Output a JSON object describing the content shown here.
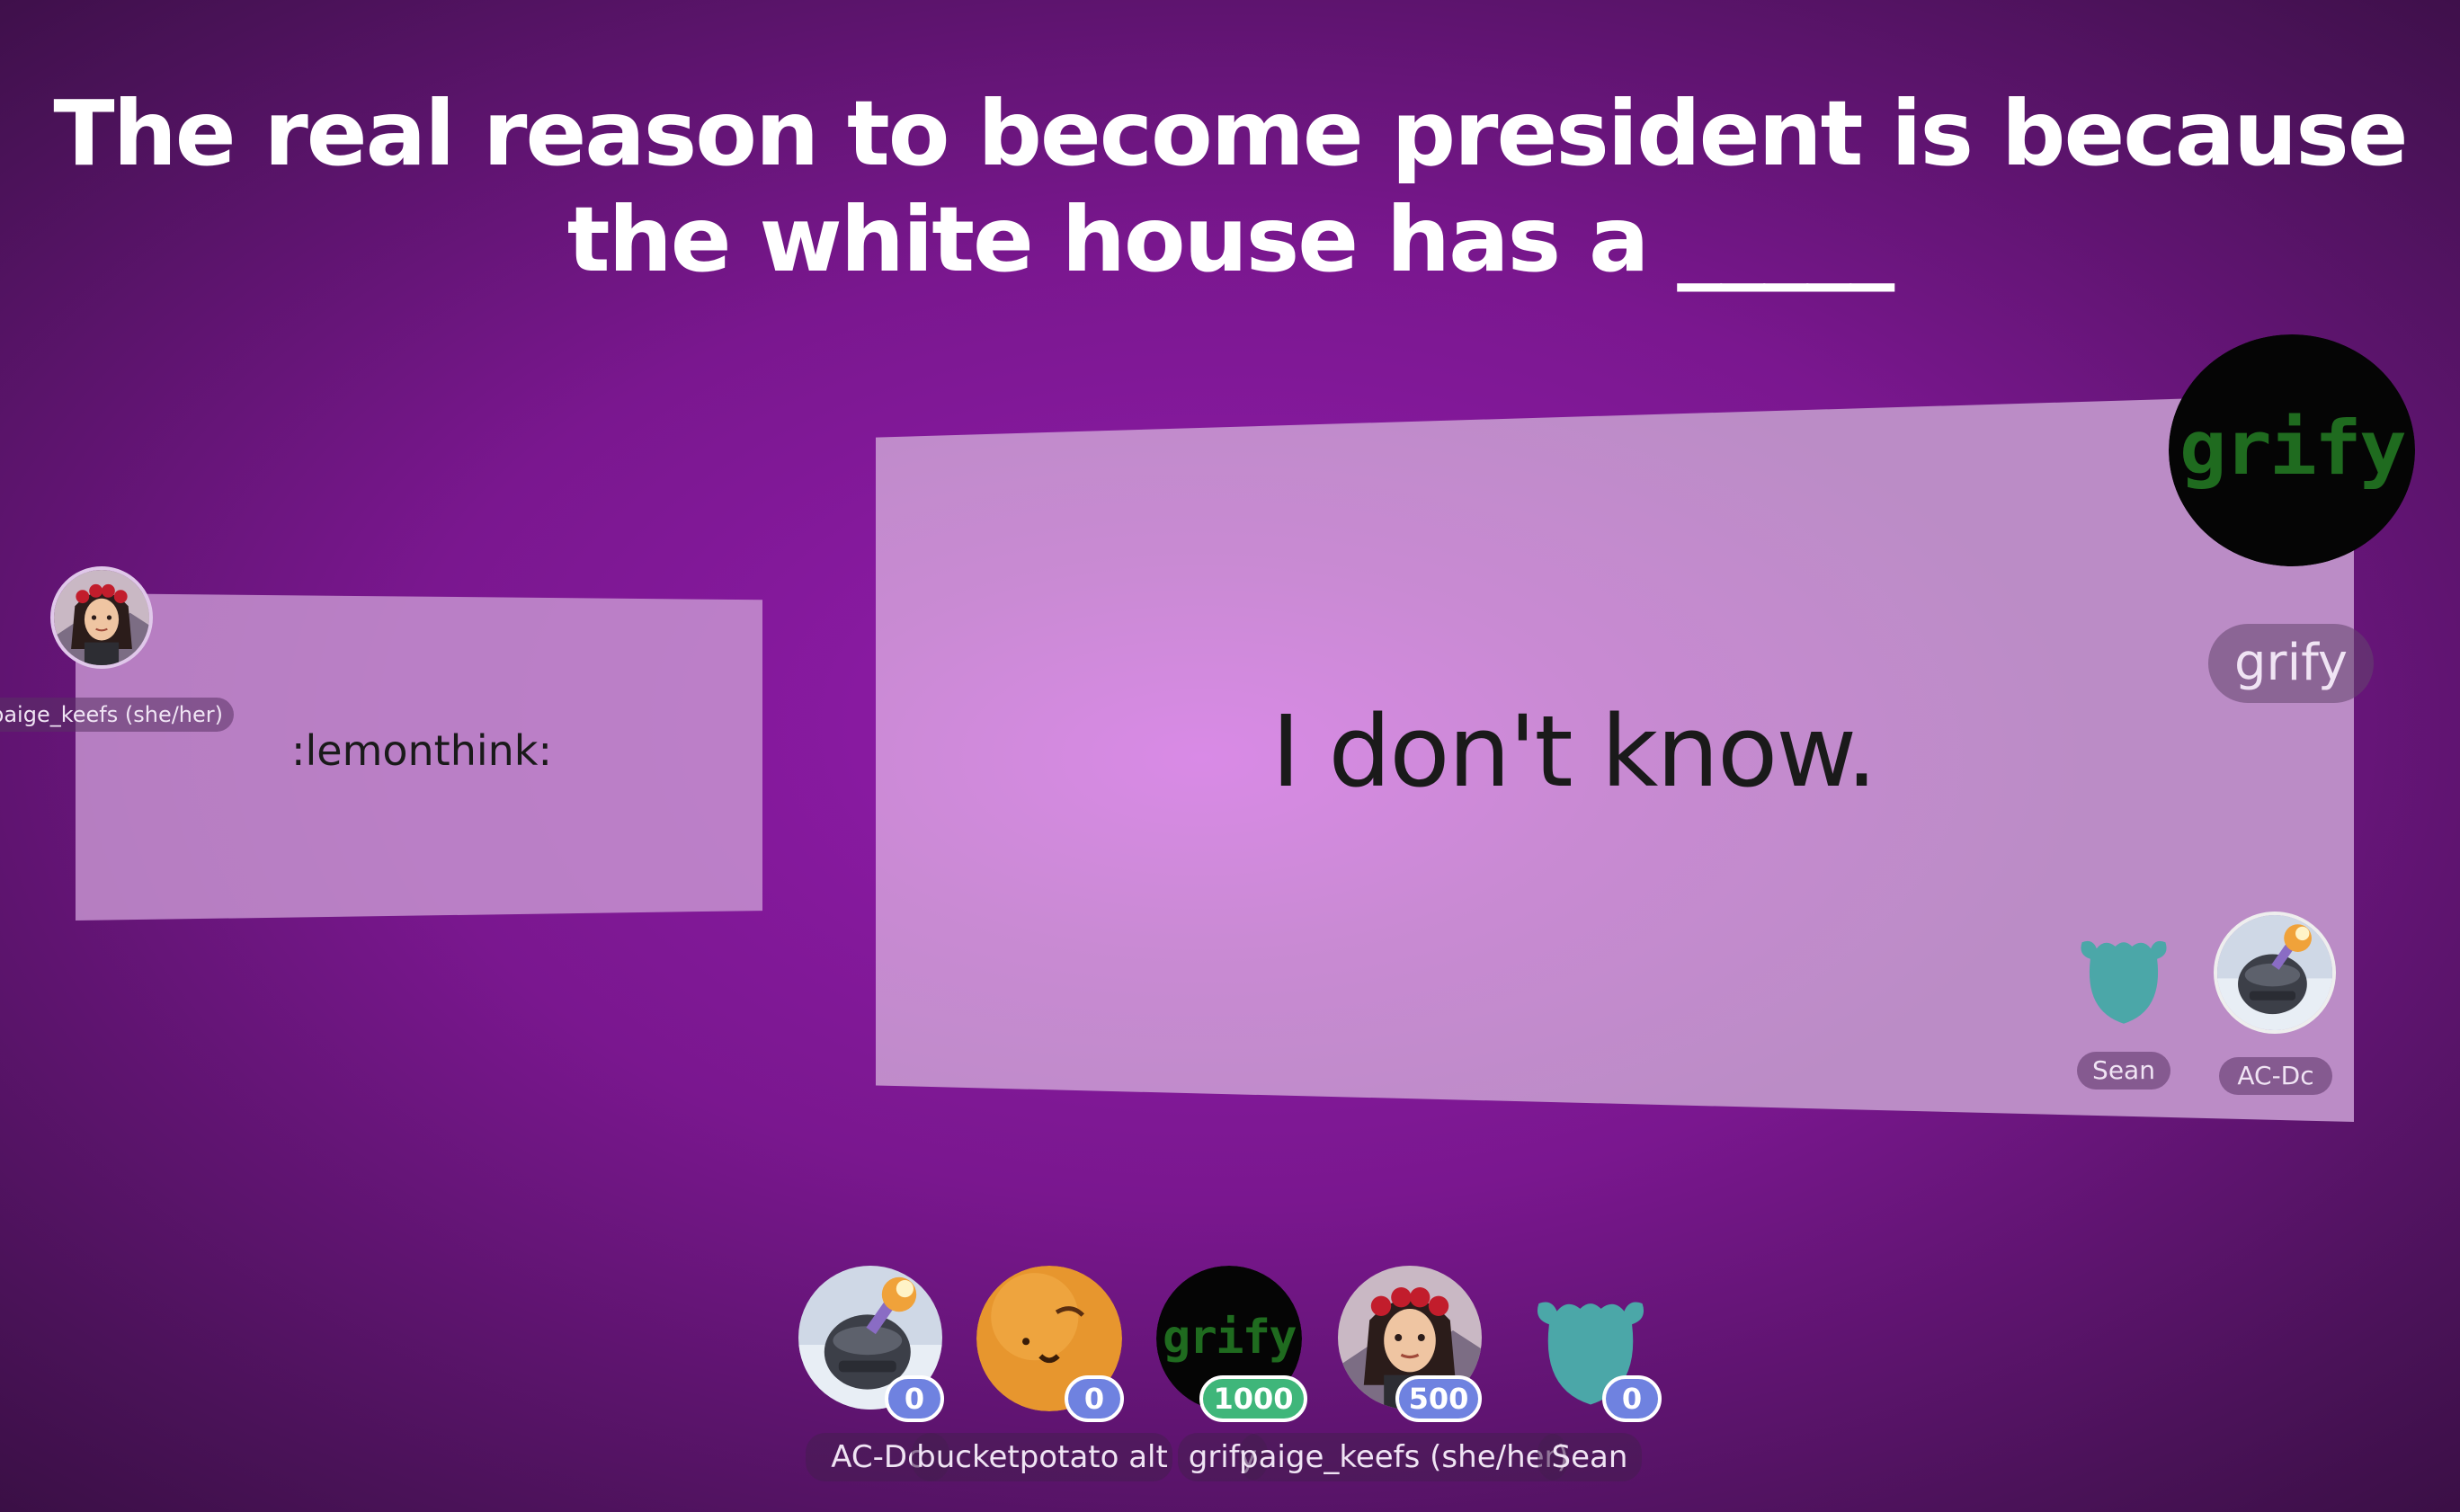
{
  "prompt": {
    "line1": "The real reason to become president is because",
    "line2": "the white house has a _____"
  },
  "answers": {
    "left": {
      "text": ":lemonthink:",
      "author": "paige_keefs (she/her)"
    },
    "main": {
      "text": "I don't know.",
      "author": "grify",
      "voters": [
        {
          "name": "Sean",
          "avatar": "teal-blob-icon"
        },
        {
          "name": "AC-Dc",
          "avatar": "pan-robot-avatar"
        }
      ]
    }
  },
  "players": [
    {
      "name": "AC-Dc",
      "score": "0",
      "badge_color": "#6f82e0",
      "avatar": "pan-robot-avatar"
    },
    {
      "name": "bucketpotato alt",
      "score": "0",
      "badge_color": "#6f82e0",
      "avatar": "orange-face-avatar"
    },
    {
      "name": "grify",
      "score": "1000",
      "badge_color": "#3fb67a",
      "avatar": "grify-logo-avatar"
    },
    {
      "name": "paige_keefs (she/her)",
      "score": "500",
      "badge_color": "#6f82e0",
      "avatar": "girl-flower-crown-avatar"
    },
    {
      "name": "Sean",
      "score": "0",
      "badge_color": "#6f82e0",
      "avatar": "teal-blob-icon"
    }
  ],
  "logo_text": "grify"
}
